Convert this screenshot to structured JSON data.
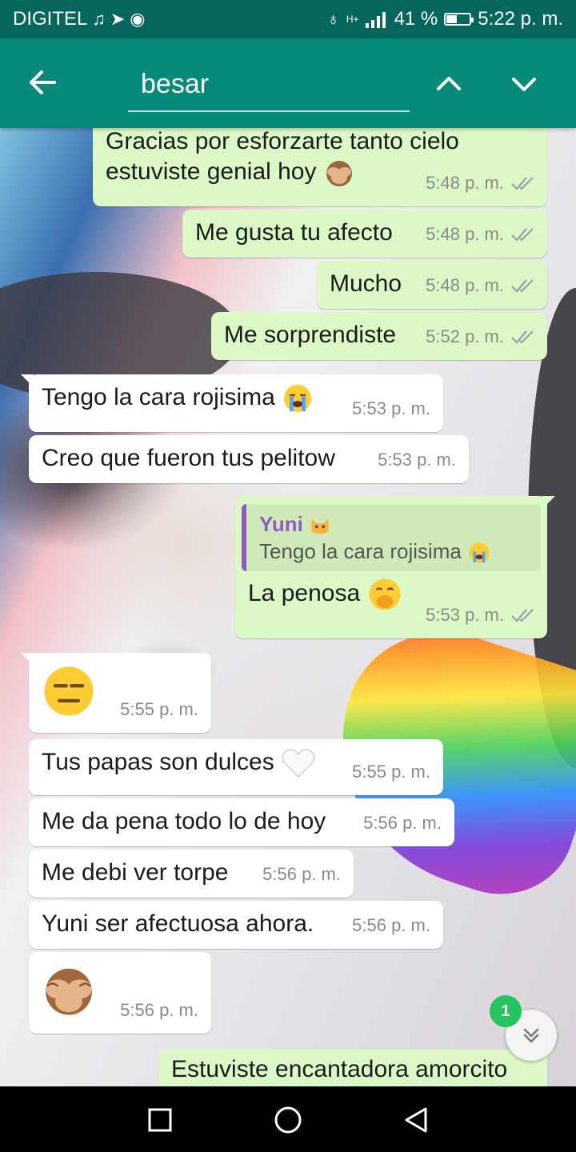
{
  "status_bar": {
    "carrier": "DIGITEL",
    "battery": "41 %",
    "time": "5:22 p. m.",
    "network": "H+",
    "battery_level": 0.41
  },
  "search": {
    "query": "besar"
  },
  "messages": [
    {
      "dir": "out",
      "text_line1": "Gracias por esforzarte tanto cielo",
      "text_line2": "estuviste genial hoy",
      "emoji": "see-no-evil-monkey",
      "time": "5:48 p. m."
    },
    {
      "dir": "out",
      "text": "Me gusta tu afecto",
      "time": "5:48 p. m."
    },
    {
      "dir": "out",
      "text": "Mucho",
      "time": "5:48 p. m."
    },
    {
      "dir": "out",
      "text": "Me sorprendiste",
      "time": "5:52 p. m."
    },
    {
      "dir": "in",
      "text": "Tengo la cara rojisima",
      "emoji": "loudly-crying-face",
      "time": "5:53 p. m."
    },
    {
      "dir": "in",
      "text": "Creo que fueron tus pelitow",
      "time": "5:53 p. m."
    },
    {
      "dir": "out",
      "quote_name": "Yuni",
      "quote_name_emoji": "cat-face",
      "quote_text": "Tengo la cara rojisima",
      "quote_emoji": "loudly-crying-face",
      "text": "La penosa",
      "emoji": "face-with-hand-over-mouth",
      "time": "5:53 p. m."
    },
    {
      "dir": "in",
      "emoji": "expressionless-face",
      "time": "5:55 p. m."
    },
    {
      "dir": "in",
      "text": "Tus papas son dulces",
      "emoji": "white-heart",
      "time": "5:55 p. m."
    },
    {
      "dir": "in",
      "text": "Me da pena todo lo de hoy",
      "time": "5:56 p. m."
    },
    {
      "dir": "in",
      "text": "Me debi ver torpe",
      "time": "5:56 p. m."
    },
    {
      "dir": "in",
      "text": "Yuni ser afectuosa ahora.",
      "time": "5:56 p. m."
    },
    {
      "dir": "in",
      "emoji": "see-no-evil-monkey",
      "time": "5:56 p. m."
    },
    {
      "dir": "out",
      "text": "Estuviste encantadora amorcito"
    }
  ],
  "unread_badge": "1",
  "colors": {
    "header": "#078a7a",
    "status_bar": "#06665c",
    "outgoing_bubble": "#dcf8c6",
    "incoming_bubble": "#ffffff",
    "quote_accent": "#8e5bbf",
    "badge": "#25c45f",
    "read_tick": "#9aa0a6"
  },
  "icons": [
    "back-arrow-icon",
    "chevron-up-icon",
    "chevron-down-icon",
    "double-check-icon",
    "scroll-down-icon",
    "nav-back-icon",
    "nav-home-icon",
    "nav-recents-icon"
  ]
}
